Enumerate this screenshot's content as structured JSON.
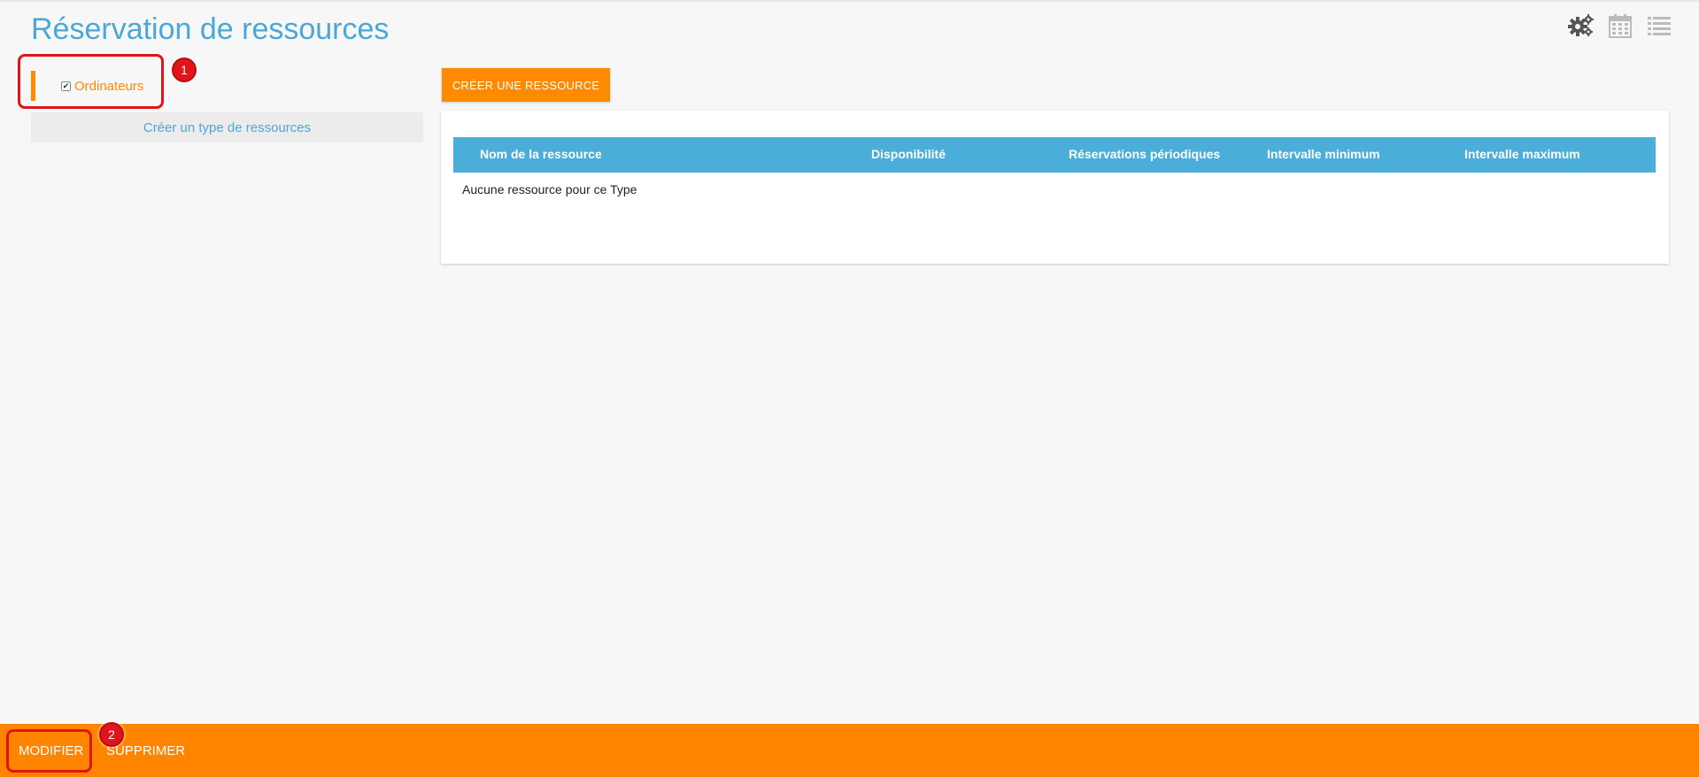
{
  "header": {
    "title": "Réservation de ressources"
  },
  "top_icons": [
    "gears-icon",
    "calendar-icon",
    "list-icon"
  ],
  "sidebar": {
    "types": [
      {
        "label": "Ordinateurs",
        "checked": true
      }
    ],
    "create_type_label": "Créer un type de ressources"
  },
  "main": {
    "create_resource_label": "CRÉER UNE RESSOURCE",
    "table": {
      "columns": [
        "Nom de la ressource",
        "Disponibilité",
        "Réservations périodiques",
        "Intervalle minimum",
        "Intervalle maximum"
      ],
      "empty_message": "Aucune ressource pour ce Type"
    }
  },
  "bottom_bar": {
    "modify_label": "MODIFIER",
    "delete_label": "SUPPRIMER"
  },
  "callouts": [
    "1",
    "2"
  ],
  "colors": {
    "accent": "#ff8a00",
    "title_blue": "#4aa8d8",
    "table_header": "#4aaed9",
    "callout_red": "#e0141a"
  }
}
